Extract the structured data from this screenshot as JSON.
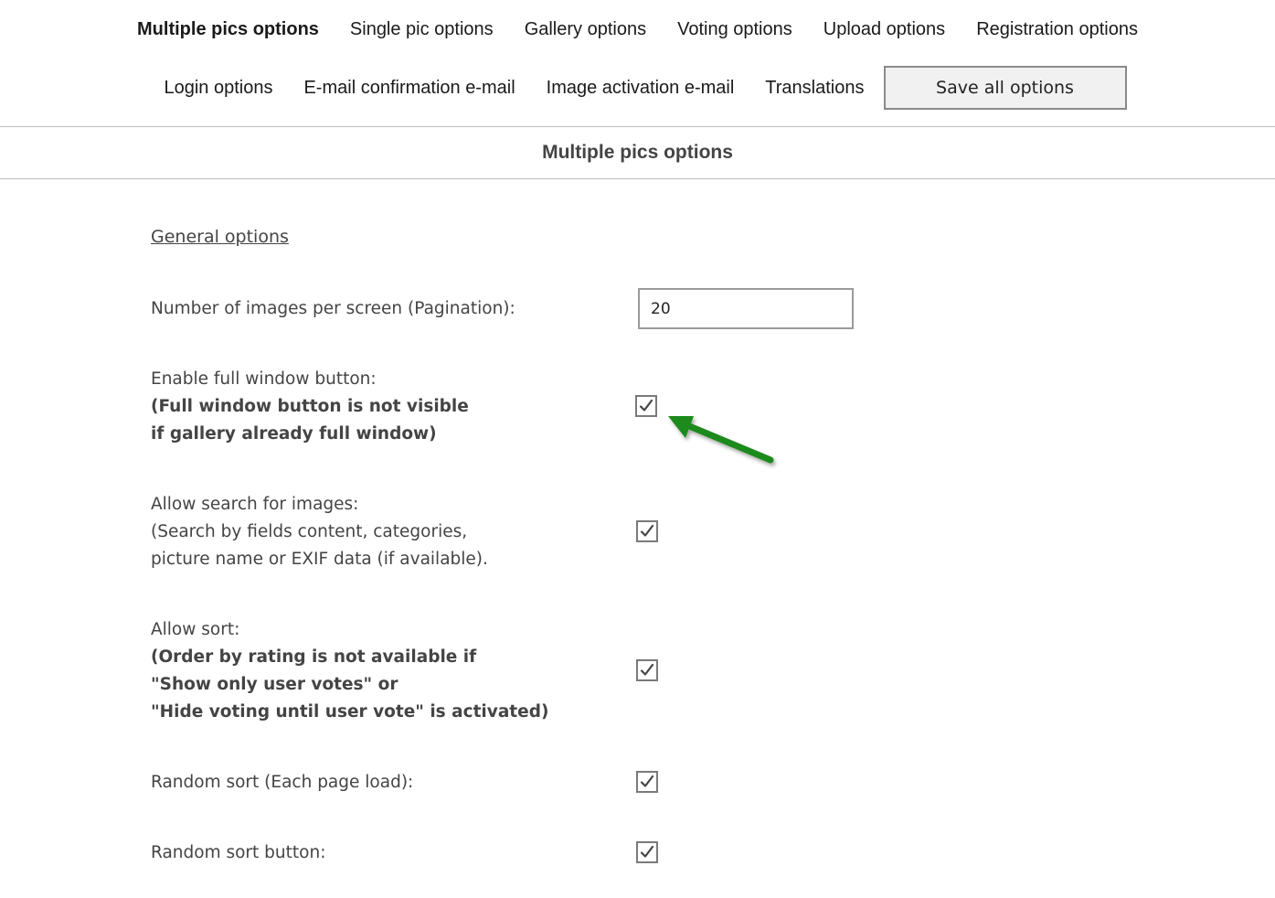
{
  "nav": {
    "row1": [
      {
        "label": "Multiple pics options",
        "active": true
      },
      {
        "label": "Single pic options"
      },
      {
        "label": "Gallery options"
      },
      {
        "label": "Voting options"
      },
      {
        "label": "Upload options"
      },
      {
        "label": "Registration options"
      }
    ],
    "row2": [
      {
        "label": "Login options"
      },
      {
        "label": "E-mail confirmation e-mail"
      },
      {
        "label": "Image activation e-mail"
      },
      {
        "label": "Translations"
      }
    ],
    "save_label": "Save all options"
  },
  "page_title": "Multiple pics options",
  "section_heading": "General options",
  "options": {
    "pagination": {
      "label": "Number of images per screen (Pagination):",
      "value": "20"
    },
    "full_window": {
      "label": "Enable full window button:",
      "note1": "(Full window button is not visible",
      "note2": "if gallery already full window)",
      "checked": true
    },
    "search": {
      "label": "Allow search for images:",
      "note1": "(Search by fields content, categories,",
      "note2": "picture name or EXIF data (if available).",
      "checked": true
    },
    "sort": {
      "label": "Allow sort:",
      "note1": "(Order by rating is not available if",
      "note2": "\"Show only user votes\" or",
      "note3": "\"Hide voting until user vote\" is activated)",
      "checked": true
    },
    "random_sort": {
      "label": "Random sort (Each page load):",
      "checked": true
    },
    "random_sort_button": {
      "label": "Random sort button:",
      "checked": true
    }
  },
  "colors": {
    "annotation_arrow": "#1e8a1e"
  },
  "icons": {
    "checkbox_mark": "checkmark-icon",
    "annotation": "arrow-icon"
  }
}
